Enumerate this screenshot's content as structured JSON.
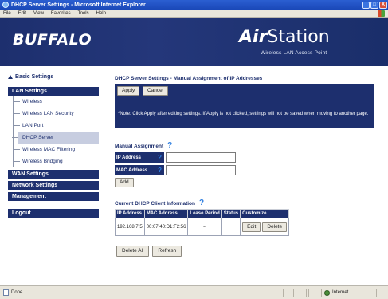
{
  "window": {
    "title": "DHCP Server Settings - Microsoft Internet Explorer",
    "controls": [
      "_",
      "□",
      "X"
    ]
  },
  "menubar": {
    "items": [
      "File",
      "Edit",
      "View",
      "Favorites",
      "Tools",
      "Help"
    ]
  },
  "banner": {
    "brand": "BUFFALO",
    "product_air": "Air",
    "product_station": "Station",
    "subtitle": "Wireless LAN Access Point"
  },
  "sidebar": {
    "basic_settings": "Basic Settings",
    "lan_header": "LAN Settings",
    "lan_items": [
      {
        "label": "Wireless"
      },
      {
        "label": "Wireless LAN Security"
      },
      {
        "label": "LAN Port"
      },
      {
        "label": "DHCP Server"
      },
      {
        "label": "Wireless MAC Filtering"
      },
      {
        "label": "Wireless Bridging"
      }
    ],
    "wan_header": "WAN Settings",
    "network_header": "Network Settings",
    "management_header": "Management",
    "logout": "Logout"
  },
  "main": {
    "heading": "DHCP Server Settings - Manual Assignment of IP Addresses",
    "apply": "Apply",
    "cancel": "Cancel",
    "note": "*Note: Click Apply after editing settings. If Apply is not clicked, settings will not be saved when moving to another page.",
    "manual_title": "Manual Assignment",
    "ip_label": "IP Address",
    "mac_label": "MAC Address",
    "ip_value": "",
    "mac_value": "",
    "add": "Add",
    "client_title": "Current DHCP Client Information",
    "table": {
      "headers": [
        "IP Address",
        "MAC Address",
        "Lease Period",
        "Status",
        "Customize"
      ],
      "row": {
        "ip": "192.168.7.5",
        "mac": "00:07:40:D1:F2:56",
        "lease": "--",
        "status": "",
        "edit": "Edit",
        "delete": "Delete"
      }
    },
    "delete_all": "Delete All",
    "refresh": "Refresh"
  },
  "statusbar": {
    "status": "Done",
    "zone": "Internet"
  },
  "help_icon_glyph": "?"
}
